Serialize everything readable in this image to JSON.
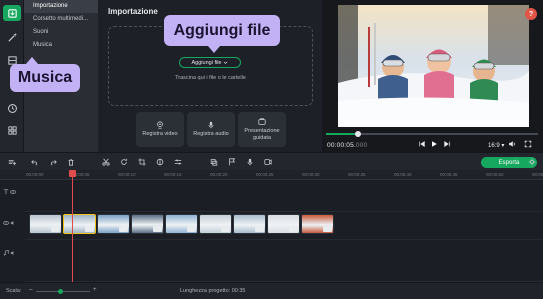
{
  "rail": {
    "items": [
      {
        "icon": "import-icon",
        "active": true
      },
      {
        "icon": "magic-wand-icon",
        "active": false
      },
      {
        "icon": "film-icon",
        "active": false
      },
      {
        "icon": "text-icon",
        "active": false
      },
      {
        "icon": "sticker-icon",
        "active": false
      },
      {
        "icon": "clock-icon",
        "active": false
      },
      {
        "icon": "grid-icon",
        "active": false
      }
    ]
  },
  "categories": [
    {
      "label": "Importazione",
      "active": true
    },
    {
      "label": "Corsetto multimedi...",
      "active": false
    },
    {
      "label": "Suoni",
      "active": false
    },
    {
      "label": "Musica",
      "active": false
    }
  ],
  "import_panel": {
    "title": "Importazione",
    "add_button": "Aggiungi file",
    "drop_hint": "Trascina qui i file o le cartelle",
    "record_buttons": [
      {
        "label": "Registra video",
        "icon": "camera-icon"
      },
      {
        "label": "Registra audio",
        "icon": "microphone-icon"
      },
      {
        "label": "Presentazione guidata",
        "icon": "presentation-icon"
      }
    ]
  },
  "callouts": {
    "add_file": "Aggiungi file",
    "music": "Musica"
  },
  "preview": {
    "timecode": "00:00:05.",
    "timecode_ms": "000",
    "aspect_ratio": "16:9",
    "progress": 0.15,
    "help": "?"
  },
  "toolbar": {
    "export_label": "Esporta"
  },
  "timeline": {
    "ticks": [
      "00:00:00",
      "00:00:05",
      "00:00:10",
      "00:00:15",
      "00:00:20",
      "00:00:25",
      "00:00:30",
      "00:00:35",
      "00:00:40",
      "00:00:45",
      "00:00:50",
      "00:00:55"
    ],
    "clips": [
      {
        "color": "#b9c4cf",
        "selected": false
      },
      {
        "color": "#9fb3c4",
        "selected": true
      },
      {
        "color": "#7ba2c6",
        "selected": false
      },
      {
        "color": "#5d6f86",
        "selected": false
      },
      {
        "color": "#8fb1d2",
        "selected": false
      },
      {
        "color": "#c4d0d8",
        "selected": false
      },
      {
        "color": "#a9bccc",
        "selected": false
      },
      {
        "color": "#d8dde2",
        "selected": false
      },
      {
        "color": "#c65a3a",
        "selected": false
      }
    ]
  },
  "status": {
    "scale_label": "Scala:",
    "zoom_level": 0.45,
    "project_length_label": "Lunghezza progetto:",
    "project_length_value": "00:35"
  },
  "colors": {
    "accent": "#17a85f",
    "callout": "#c3b1f5",
    "playhead": "#e24b4b"
  }
}
